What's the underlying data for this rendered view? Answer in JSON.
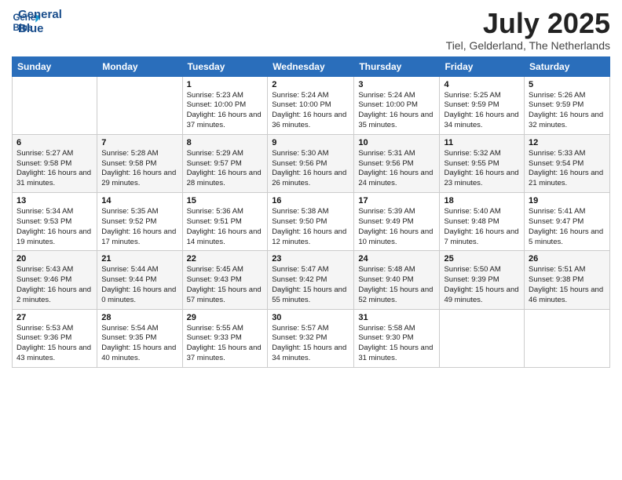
{
  "header": {
    "logo_line1": "General",
    "logo_line2": "Blue",
    "month_title": "July 2025",
    "subtitle": "Tiel, Gelderland, The Netherlands"
  },
  "weekdays": [
    "Sunday",
    "Monday",
    "Tuesday",
    "Wednesday",
    "Thursday",
    "Friday",
    "Saturday"
  ],
  "weeks": [
    [
      {
        "day": "",
        "sunrise": "",
        "sunset": "",
        "daylight": ""
      },
      {
        "day": "",
        "sunrise": "",
        "sunset": "",
        "daylight": ""
      },
      {
        "day": "1",
        "sunrise": "Sunrise: 5:23 AM",
        "sunset": "Sunset: 10:00 PM",
        "daylight": "Daylight: 16 hours and 37 minutes."
      },
      {
        "day": "2",
        "sunrise": "Sunrise: 5:24 AM",
        "sunset": "Sunset: 10:00 PM",
        "daylight": "Daylight: 16 hours and 36 minutes."
      },
      {
        "day": "3",
        "sunrise": "Sunrise: 5:24 AM",
        "sunset": "Sunset: 10:00 PM",
        "daylight": "Daylight: 16 hours and 35 minutes."
      },
      {
        "day": "4",
        "sunrise": "Sunrise: 5:25 AM",
        "sunset": "Sunset: 9:59 PM",
        "daylight": "Daylight: 16 hours and 34 minutes."
      },
      {
        "day": "5",
        "sunrise": "Sunrise: 5:26 AM",
        "sunset": "Sunset: 9:59 PM",
        "daylight": "Daylight: 16 hours and 32 minutes."
      }
    ],
    [
      {
        "day": "6",
        "sunrise": "Sunrise: 5:27 AM",
        "sunset": "Sunset: 9:58 PM",
        "daylight": "Daylight: 16 hours and 31 minutes."
      },
      {
        "day": "7",
        "sunrise": "Sunrise: 5:28 AM",
        "sunset": "Sunset: 9:58 PM",
        "daylight": "Daylight: 16 hours and 29 minutes."
      },
      {
        "day": "8",
        "sunrise": "Sunrise: 5:29 AM",
        "sunset": "Sunset: 9:57 PM",
        "daylight": "Daylight: 16 hours and 28 minutes."
      },
      {
        "day": "9",
        "sunrise": "Sunrise: 5:30 AM",
        "sunset": "Sunset: 9:56 PM",
        "daylight": "Daylight: 16 hours and 26 minutes."
      },
      {
        "day": "10",
        "sunrise": "Sunrise: 5:31 AM",
        "sunset": "Sunset: 9:56 PM",
        "daylight": "Daylight: 16 hours and 24 minutes."
      },
      {
        "day": "11",
        "sunrise": "Sunrise: 5:32 AM",
        "sunset": "Sunset: 9:55 PM",
        "daylight": "Daylight: 16 hours and 23 minutes."
      },
      {
        "day": "12",
        "sunrise": "Sunrise: 5:33 AM",
        "sunset": "Sunset: 9:54 PM",
        "daylight": "Daylight: 16 hours and 21 minutes."
      }
    ],
    [
      {
        "day": "13",
        "sunrise": "Sunrise: 5:34 AM",
        "sunset": "Sunset: 9:53 PM",
        "daylight": "Daylight: 16 hours and 19 minutes."
      },
      {
        "day": "14",
        "sunrise": "Sunrise: 5:35 AM",
        "sunset": "Sunset: 9:52 PM",
        "daylight": "Daylight: 16 hours and 17 minutes."
      },
      {
        "day": "15",
        "sunrise": "Sunrise: 5:36 AM",
        "sunset": "Sunset: 9:51 PM",
        "daylight": "Daylight: 16 hours and 14 minutes."
      },
      {
        "day": "16",
        "sunrise": "Sunrise: 5:38 AM",
        "sunset": "Sunset: 9:50 PM",
        "daylight": "Daylight: 16 hours and 12 minutes."
      },
      {
        "day": "17",
        "sunrise": "Sunrise: 5:39 AM",
        "sunset": "Sunset: 9:49 PM",
        "daylight": "Daylight: 16 hours and 10 minutes."
      },
      {
        "day": "18",
        "sunrise": "Sunrise: 5:40 AM",
        "sunset": "Sunset: 9:48 PM",
        "daylight": "Daylight: 16 hours and 7 minutes."
      },
      {
        "day": "19",
        "sunrise": "Sunrise: 5:41 AM",
        "sunset": "Sunset: 9:47 PM",
        "daylight": "Daylight: 16 hours and 5 minutes."
      }
    ],
    [
      {
        "day": "20",
        "sunrise": "Sunrise: 5:43 AM",
        "sunset": "Sunset: 9:46 PM",
        "daylight": "Daylight: 16 hours and 2 minutes."
      },
      {
        "day": "21",
        "sunrise": "Sunrise: 5:44 AM",
        "sunset": "Sunset: 9:44 PM",
        "daylight": "Daylight: 16 hours and 0 minutes."
      },
      {
        "day": "22",
        "sunrise": "Sunrise: 5:45 AM",
        "sunset": "Sunset: 9:43 PM",
        "daylight": "Daylight: 15 hours and 57 minutes."
      },
      {
        "day": "23",
        "sunrise": "Sunrise: 5:47 AM",
        "sunset": "Sunset: 9:42 PM",
        "daylight": "Daylight: 15 hours and 55 minutes."
      },
      {
        "day": "24",
        "sunrise": "Sunrise: 5:48 AM",
        "sunset": "Sunset: 9:40 PM",
        "daylight": "Daylight: 15 hours and 52 minutes."
      },
      {
        "day": "25",
        "sunrise": "Sunrise: 5:50 AM",
        "sunset": "Sunset: 9:39 PM",
        "daylight": "Daylight: 15 hours and 49 minutes."
      },
      {
        "day": "26",
        "sunrise": "Sunrise: 5:51 AM",
        "sunset": "Sunset: 9:38 PM",
        "daylight": "Daylight: 15 hours and 46 minutes."
      }
    ],
    [
      {
        "day": "27",
        "sunrise": "Sunrise: 5:53 AM",
        "sunset": "Sunset: 9:36 PM",
        "daylight": "Daylight: 15 hours and 43 minutes."
      },
      {
        "day": "28",
        "sunrise": "Sunrise: 5:54 AM",
        "sunset": "Sunset: 9:35 PM",
        "daylight": "Daylight: 15 hours and 40 minutes."
      },
      {
        "day": "29",
        "sunrise": "Sunrise: 5:55 AM",
        "sunset": "Sunset: 9:33 PM",
        "daylight": "Daylight: 15 hours and 37 minutes."
      },
      {
        "day": "30",
        "sunrise": "Sunrise: 5:57 AM",
        "sunset": "Sunset: 9:32 PM",
        "daylight": "Daylight: 15 hours and 34 minutes."
      },
      {
        "day": "31",
        "sunrise": "Sunrise: 5:58 AM",
        "sunset": "Sunset: 9:30 PM",
        "daylight": "Daylight: 15 hours and 31 minutes."
      },
      {
        "day": "",
        "sunrise": "",
        "sunset": "",
        "daylight": ""
      },
      {
        "day": "",
        "sunrise": "",
        "sunset": "",
        "daylight": ""
      }
    ]
  ]
}
